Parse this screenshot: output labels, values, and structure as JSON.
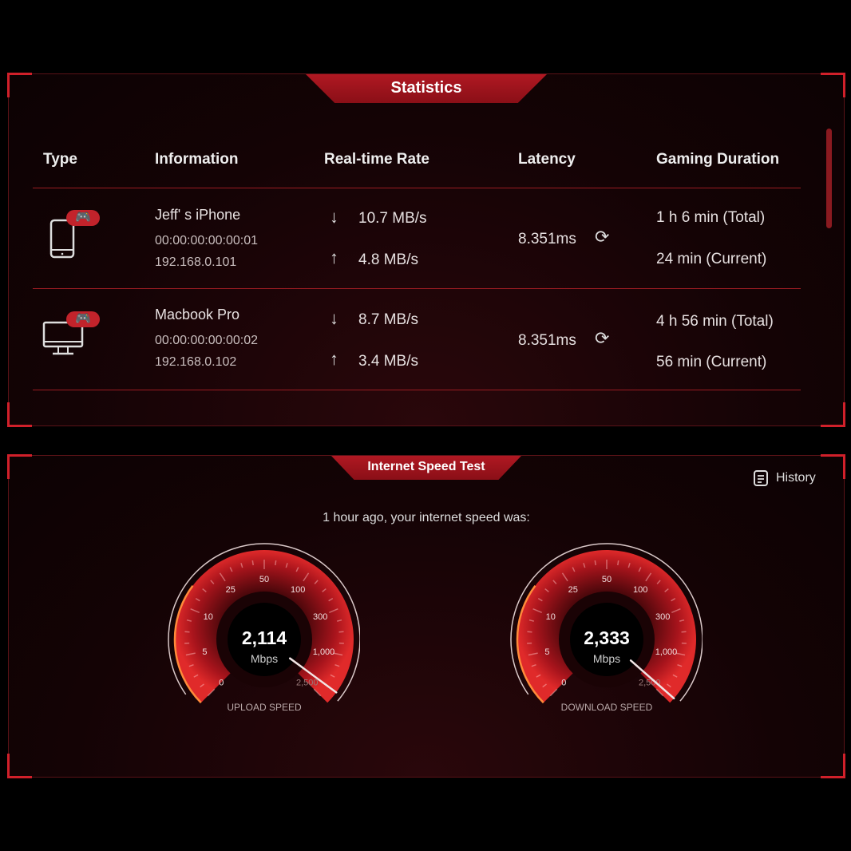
{
  "statistics": {
    "title": "Statistics",
    "columns": [
      "Type",
      "Information",
      "Real-time Rate",
      "Latency",
      "Gaming Duration"
    ],
    "rows": [
      {
        "type_icon": "smartphone-icon",
        "name": "Jeff' s iPhone",
        "mac": "00:00:00:00:00:01",
        "ip": "192.168.0.101",
        "download": "10.7 MB/s",
        "upload": "4.8 MB/s",
        "latency": "8.351ms",
        "total": "1 h 6 min (Total)",
        "current": "24 min (Current)"
      },
      {
        "type_icon": "desktop-icon",
        "name": "Macbook Pro",
        "mac": "00:00:00:00:00:02",
        "ip": "192.168.0.102",
        "download": "8.7 MB/s",
        "upload": "3.4 MB/s",
        "latency": "8.351ms",
        "total": "4 h 56 min (Total)",
        "current": "56 min (Current)"
      }
    ]
  },
  "speed_test": {
    "title": "Internet Speed Test",
    "history_label": "History",
    "subtitle": "1 hour ago, your internet speed was:",
    "scale_labels": [
      "0",
      "5",
      "10",
      "25",
      "50",
      "100",
      "300",
      "1,000",
      "2,500"
    ],
    "scale_values": [
      0,
      5,
      10,
      25,
      50,
      100,
      300,
      1000,
      2500
    ],
    "gauges": [
      {
        "value": 2114,
        "value_text": "2,114",
        "unit": "Mbps",
        "label": "UPLOAD SPEED"
      },
      {
        "value": 2333,
        "value_text": "2,333",
        "unit": "Mbps",
        "label": "DOWNLOAD SPEED"
      }
    ]
  },
  "colors": {
    "accent": "#c2232b",
    "rule": "#9a1c22",
    "background": "#140305"
  }
}
